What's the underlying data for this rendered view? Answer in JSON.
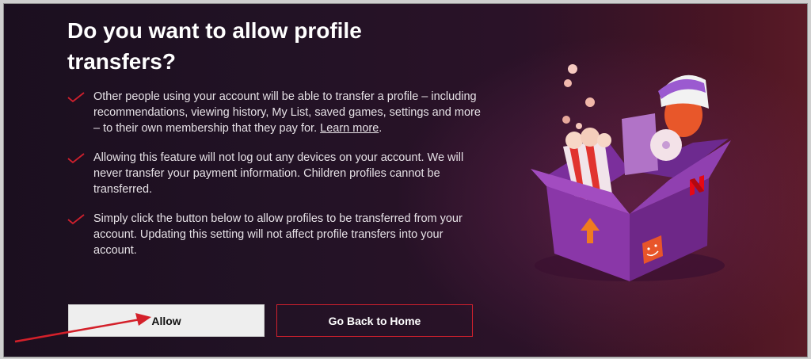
{
  "dialog": {
    "title": "Do you want to allow profile transfers?",
    "items": [
      {
        "text": "Other people using your account will be able to transfer a profile – including recommendations, viewing history, My List, saved games, settings and more – to their own membership that they pay for. ",
        "link": "Learn more",
        "suffix": "."
      },
      {
        "text": "Allowing this feature will not log out any devices on your account. We will never transfer your payment information. Children profiles cannot be transferred."
      },
      {
        "text": "Simply click the button below to allow profiles to be transferred from your account. Updating this setting will not affect profile transfers into your account."
      }
    ],
    "allow_button": "Allow",
    "home_button": "Go Back to Home"
  },
  "colors": {
    "check": "#d0202d",
    "allow_bg": "#eeeeee",
    "home_border": "#d0202d",
    "annotation_arrow": "#d4202a"
  },
  "icons": {
    "check": "check-icon",
    "illustration": "gift-box-illustration",
    "logo": "netflix-logo",
    "arrow": "annotation-arrow"
  }
}
